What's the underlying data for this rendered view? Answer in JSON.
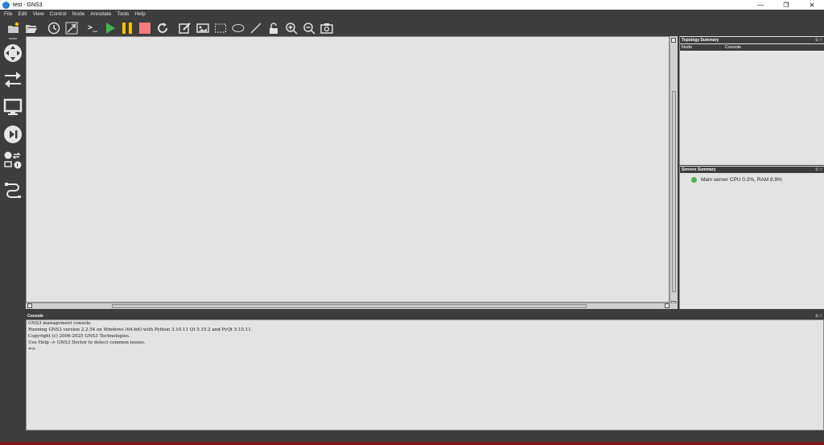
{
  "window": {
    "title": "test - GNS3",
    "minimize": "—",
    "restore": "❐",
    "close": "✕"
  },
  "menu": [
    "File",
    "Edit",
    "View",
    "Control",
    "Node",
    "Annotate",
    "Tools",
    "Help"
  ],
  "toolbar": {
    "icons": [
      "new-project-icon",
      "open-project-icon",
      "snapshot-icon",
      "show-interface-labels-icon",
      "console-all-icon",
      "start-all-icon",
      "suspend-all-icon",
      "stop-all-icon",
      "reload-all-icon",
      "add-note-icon",
      "insert-image-icon",
      "draw-rectangle-icon",
      "draw-ellipse-icon",
      "draw-line-icon",
      "lock-icon",
      "zoom-in-icon",
      "zoom-out-icon",
      "screenshot-icon"
    ],
    "console_glyph": ">_"
  },
  "colors": {
    "start": "#3fb34f",
    "suspend": "#f5c000",
    "stop": "#f07c7c",
    "server_ok": "#4caf50"
  },
  "topology": {
    "title": "Topology Summary",
    "controls": "⧉ ✕",
    "columns": [
      "Node",
      "Console"
    ]
  },
  "servers": {
    "title": "Servers Summary",
    "controls": "⧉ ✕",
    "items": [
      "Main server CPU 0.2%, RAM 8.9%"
    ]
  },
  "console": {
    "title": "Console",
    "controls": "⧉ ✕",
    "lines": [
      "GNS3 management console.",
      "Running GNS3 version 2.2.54 on Windows (64-bit) with Python 3.10.11 Qt 5.15.2 and PyQt 5.15.11.",
      "Copyright (c) 2006-2025 GNS3 Technologies.",
      "Use Help -> GNS3 Doctor to detect common issues.",
      "",
      "=>"
    ]
  }
}
